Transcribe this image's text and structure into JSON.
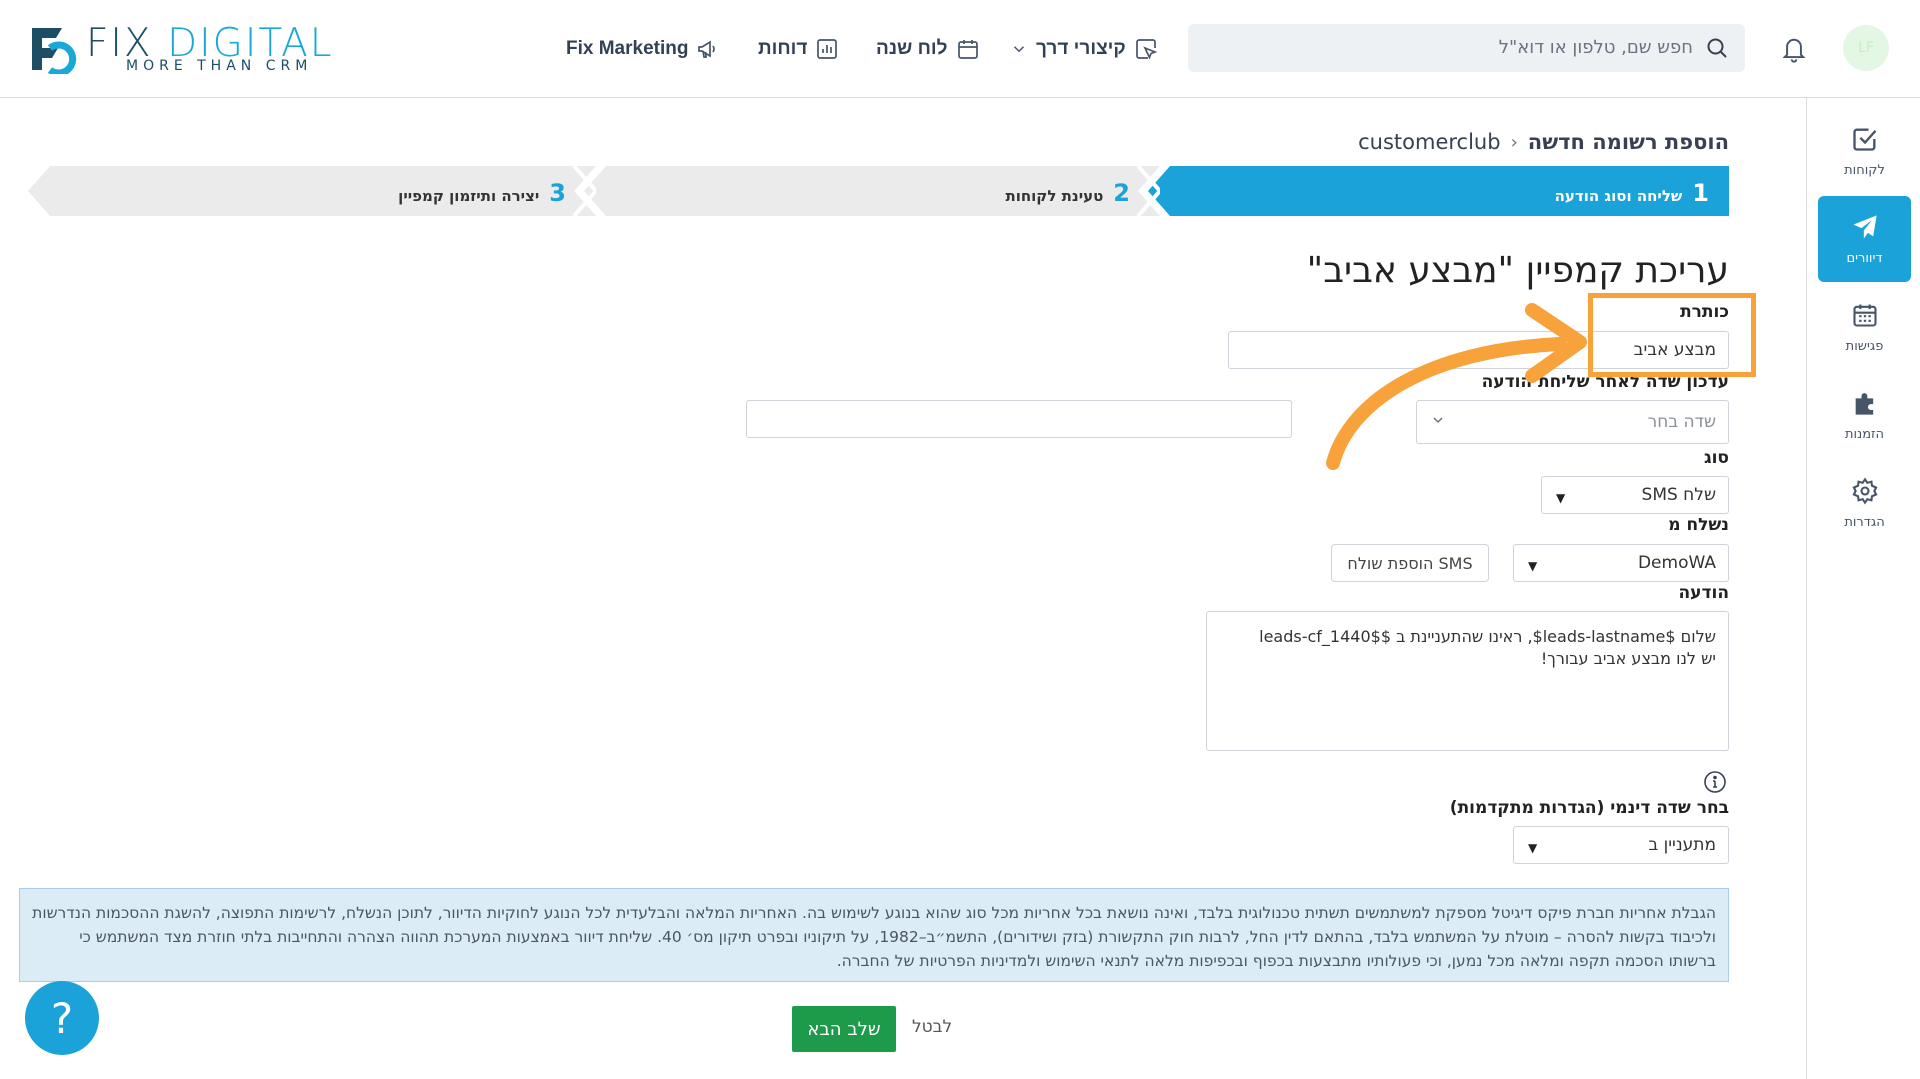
{
  "header": {
    "logo": {
      "brand_fix": "FIX",
      "brand_digital": "DIGITAL",
      "tagline": "MORE THAN CRM"
    },
    "nav": [
      {
        "label": "Fix Marketing",
        "icon": "megaphone-icon"
      },
      {
        "label": "דוחות",
        "icon": "bar-chart-icon"
      },
      {
        "label": "לוח שנה",
        "icon": "calendar-icon"
      },
      {
        "label": "קיצורי דרך",
        "icon": "cursor-click-icon"
      }
    ],
    "search": {
      "placeholder": "חפש שם, טלפון או דוא\"ל"
    },
    "avatar_initials": "LF"
  },
  "sidebar": {
    "items": [
      {
        "label": "לקוחות",
        "icon": "checkbox-icon",
        "active": false
      },
      {
        "label": "דיוורים",
        "icon": "paper-plane-icon",
        "active": true
      },
      {
        "label": "פגישות",
        "icon": "calendar-icon",
        "active": false
      },
      {
        "label": "הזמנות",
        "icon": "puzzle-icon",
        "active": false
      },
      {
        "label": "הגדרות",
        "icon": "gear-icon",
        "active": false
      }
    ]
  },
  "breadcrumb": {
    "root": "customerclub",
    "current": "הוספת רשומה חדשה"
  },
  "wizard": {
    "steps": [
      {
        "number": "1",
        "label": "שליחה וסוג הודעה",
        "active": true
      },
      {
        "number": "2",
        "label": "טעינת לקוחות",
        "active": false
      },
      {
        "number": "3",
        "label": "יצירה ותיזמון קמפיין",
        "active": false
      }
    ]
  },
  "form": {
    "title": "עריכת קמפיין \"מבצע אביב\"",
    "subject_label": "כותרת",
    "subject_value": "מבצע אביב",
    "update_field_label": "עדכון שדה לאחר שליחת הודעה",
    "update_field_placeholder": "שדה בחר",
    "type_label": "סוג",
    "type_value": "שלח SMS",
    "sender_label": "נשלח מ",
    "sender_value": "DemoWA",
    "add_sender_button": "הוספת שולח SMS",
    "message_label": "הודעה",
    "message_lines": [
      "שלום $leads-lastname$, ראינו שהתעניינת ב $$leads-cf_1440",
      "יש לנו מבצע אביב עבורך!"
    ],
    "dynamic_field_label": "בחר שדה דינמי (הגדרות מתקדמות)",
    "dynamic_field_value": "מתעניין ב"
  },
  "notice": {
    "text": "הגבלת אחריות חברת פיקס דיגיטל מספקת למשתמשים תשתית טכנולוגית בלבד, ואינה נושאת בכל אחריות מכל סוג שהוא בנוגע לשימוש בה. האחריות המלאה והבלעדית לכל הנוגע לחוקיות הדיוור, לתוכן הנשלח, לרשימות התפוצה, להשגת ההסכמות הנדרשות ולכיבוד בקשות להסרה – מוטלת על המשתמש בלבד, בהתאם לדין החל, לרבות חוק התקשורת (בזק ושידורים), התשמ״ב–1982, על תיקוניו ובפרט תיקון מס׳ 40. שליחת דיוור באמצעות המערכת תהווה הצהרה והתחייבות בלתי חוזרת מצד המשתמש כי ברשותו הסכמה תקפה ומלאה מכל נמען, וכי פעולותיו מתבצעות בכפוף ובכפיפות מלאה לתנאי השימוש ולמדיניות הפרטיות של החברה."
  },
  "actions": {
    "next": "שלב הבא",
    "cancel": "לבטל"
  },
  "help_glyph": "?",
  "colors": {
    "accent": "#1ba2d8",
    "next_button": "#1e9b4a",
    "annotation": "#f7a23b"
  }
}
